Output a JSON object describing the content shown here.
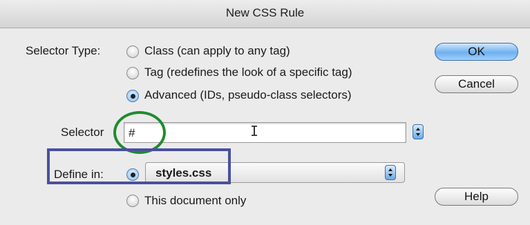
{
  "window": {
    "title": "New CSS Rule"
  },
  "selector_type": {
    "label": "Selector Type:",
    "options": [
      {
        "label": "Class (can apply to any tag)",
        "selected": false
      },
      {
        "label": "Tag (redefines the look of a specific tag)",
        "selected": false
      },
      {
        "label": "Advanced (IDs, pseudo-class selectors)",
        "selected": true
      }
    ]
  },
  "selector": {
    "label": "Selector",
    "value": "#"
  },
  "define_in": {
    "label": "Define in:",
    "file_value": "styles.css",
    "file_selected": true,
    "other_option": "This document only"
  },
  "buttons": {
    "ok": "OK",
    "cancel": "Cancel",
    "help": "Help"
  },
  "colors": {
    "circle_annotation": "#1e8c2e",
    "rect_annotation": "#4a4fa0",
    "default_button": "#6fb0ee"
  }
}
